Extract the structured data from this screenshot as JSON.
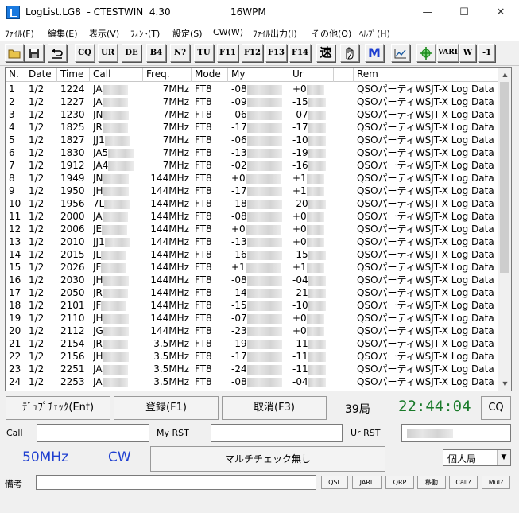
{
  "window": {
    "title": "LogList.LG8  - CTESTWIN  4.30",
    "wpm": "16WPM",
    "minimize": "—",
    "maximize": "☐",
    "close": "✕"
  },
  "menu": [
    "ﾌｧｲﾙ(F)",
    "編集(E)",
    "表示(V)",
    "ﾌｫﾝﾄ(T)",
    "設定(S)",
    "CW(W)",
    "ﾌｧｲﾙ出力(I)",
    "その他(O)",
    "ﾍﾙﾌﾟ(H)"
  ],
  "toolbar": {
    "buttons": [
      "CQ",
      "UR",
      "DE",
      "B4",
      "N?",
      "TU",
      "F11",
      "F12",
      "F13",
      "F14"
    ],
    "speed": "速",
    "m_label": "M",
    "vari": "VARI",
    "w": "W",
    "minus1": "-1"
  },
  "log": {
    "columns": [
      "N.",
      "Date",
      "Time",
      "Call",
      "Freq.",
      "Mode",
      "My",
      "Ur",
      "",
      "",
      "Rem"
    ],
    "rows": [
      {
        "n": "1",
        "date": "1/2",
        "time": "1224",
        "call": "JA",
        "freq": "7MHz",
        "mode": "FT8",
        "my": "-08",
        "ur": "+0",
        "rem": "QSOパーティWSJT-X Log Data"
      },
      {
        "n": "2",
        "date": "1/2",
        "time": "1227",
        "call": "JA",
        "freq": "7MHz",
        "mode": "FT8",
        "my": "-09",
        "ur": "-15",
        "rem": "QSOパーティWSJT-X Log Data"
      },
      {
        "n": "3",
        "date": "1/2",
        "time": "1230",
        "call": "JN",
        "freq": "7MHz",
        "mode": "FT8",
        "my": "-06",
        "ur": "-07",
        "rem": "QSOパーティWSJT-X Log Data"
      },
      {
        "n": "4",
        "date": "1/2",
        "time": "1825",
        "call": "JR",
        "freq": "7MHz",
        "mode": "FT8",
        "my": "-17",
        "ur": "-17",
        "rem": "QSOパーティWSJT-X Log Data"
      },
      {
        "n": "5",
        "date": "1/2",
        "time": "1827",
        "call": "JJ1",
        "freq": "7MHz",
        "mode": "FT8",
        "my": "-06",
        "ur": "-10",
        "rem": "QSOパーティWSJT-X Log Data"
      },
      {
        "n": "6",
        "date": "1/2",
        "time": "1830",
        "call": "JA5",
        "freq": "7MHz",
        "mode": "FT8",
        "my": "-13",
        "ur": "-19",
        "rem": "QSOパーティWSJT-X Log Data"
      },
      {
        "n": "7",
        "date": "1/2",
        "time": "1912",
        "call": "JA4",
        "freq": "7MHz",
        "mode": "FT8",
        "my": "-02",
        "ur": "-16",
        "rem": "QSOパーティWSJT-X Log Data"
      },
      {
        "n": "8",
        "date": "1/2",
        "time": "1949",
        "call": "JN",
        "freq": "144MHz",
        "mode": "FT8",
        "my": "+0",
        "ur": "+1",
        "rem": "QSOパーティWSJT-X Log Data"
      },
      {
        "n": "9",
        "date": "1/2",
        "time": "1950",
        "call": "JH",
        "freq": "144MHz",
        "mode": "FT8",
        "my": "-17",
        "ur": "+1",
        "rem": "QSOパーティWSJT-X Log Data"
      },
      {
        "n": "10",
        "date": "1/2",
        "time": "1956",
        "call": "7L",
        "freq": "144MHz",
        "mode": "FT8",
        "my": "-18",
        "ur": "-20",
        "rem": "QSOパーティWSJT-X Log Data"
      },
      {
        "n": "11",
        "date": "1/2",
        "time": "2000",
        "call": "JA",
        "freq": "144MHz",
        "mode": "FT8",
        "my": "-08",
        "ur": "+0",
        "rem": "QSOパーティWSJT-X Log Data"
      },
      {
        "n": "12",
        "date": "1/2",
        "time": "2006",
        "call": "JE",
        "freq": "144MHz",
        "mode": "FT8",
        "my": "+0",
        "ur": "+0",
        "rem": "QSOパーティWSJT-X Log Data"
      },
      {
        "n": "13",
        "date": "1/2",
        "time": "2010",
        "call": "JJ1",
        "freq": "144MHz",
        "mode": "FT8",
        "my": "-13",
        "ur": "+0",
        "rem": "QSOパーティWSJT-X Log Data"
      },
      {
        "n": "14",
        "date": "1/2",
        "time": "2015",
        "call": "JL",
        "freq": "144MHz",
        "mode": "FT8",
        "my": "-16",
        "ur": "-15",
        "rem": "QSOパーティWSJT-X Log Data"
      },
      {
        "n": "15",
        "date": "1/2",
        "time": "2026",
        "call": "JF",
        "freq": "144MHz",
        "mode": "FT8",
        "my": "+1",
        "ur": "+1",
        "rem": "QSOパーティWSJT-X Log Data"
      },
      {
        "n": "16",
        "date": "1/2",
        "time": "2030",
        "call": "JH",
        "freq": "144MHz",
        "mode": "FT8",
        "my": "-08",
        "ur": "-04",
        "rem": "QSOパーティWSJT-X Log Data"
      },
      {
        "n": "17",
        "date": "1/2",
        "time": "2050",
        "call": "JR",
        "freq": "144MHz",
        "mode": "FT8",
        "my": "-14",
        "ur": "-21",
        "rem": "QSOパーティWSJT-X Log Data"
      },
      {
        "n": "18",
        "date": "1/2",
        "time": "2101",
        "call": "JF",
        "freq": "144MHz",
        "mode": "FT8",
        "my": "-15",
        "ur": "-10",
        "rem": "QSOパーティWSJT-X Log Data"
      },
      {
        "n": "19",
        "date": "1/2",
        "time": "2110",
        "call": "JH",
        "freq": "144MHz",
        "mode": "FT8",
        "my": "-07",
        "ur": "+0",
        "rem": "QSOパーティWSJT-X Log Data"
      },
      {
        "n": "20",
        "date": "1/2",
        "time": "2112",
        "call": "JG",
        "freq": "144MHz",
        "mode": "FT8",
        "my": "-23",
        "ur": "+0",
        "rem": "QSOパーティWSJT-X Log Data"
      },
      {
        "n": "21",
        "date": "1/2",
        "time": "2154",
        "call": "JR",
        "freq": "3.5MHz",
        "mode": "FT8",
        "my": "-19",
        "ur": "-11",
        "rem": "QSOパーティWSJT-X Log Data"
      },
      {
        "n": "22",
        "date": "1/2",
        "time": "2156",
        "call": "JH",
        "freq": "3.5MHz",
        "mode": "FT8",
        "my": "-17",
        "ur": "-11",
        "rem": "QSOパーティWSJT-X Log Data"
      },
      {
        "n": "23",
        "date": "1/2",
        "time": "2251",
        "call": "JA",
        "freq": "3.5MHz",
        "mode": "FT8",
        "my": "-24",
        "ur": "-11",
        "rem": "QSOパーティWSJT-X Log Data"
      },
      {
        "n": "24",
        "date": "1/2",
        "time": "2253",
        "call": "JA",
        "freq": "3.5MHz",
        "mode": "FT8",
        "my": "-08",
        "ur": "-04",
        "rem": "QSOパーティWSJT-X Log Data"
      }
    ]
  },
  "controls": {
    "dupe_check": "ﾃﾞｭﾌﾟﾁｪｯｸ(Ent)",
    "register": "登録(F1)",
    "cancel": "取消(F3)",
    "count": "39局",
    "clock": "22:44:04",
    "cq": "CQ",
    "call_label": "Call",
    "my_rst_label": "My RST",
    "ur_rst_label": "Ur RST",
    "band": "50MHz",
    "mode": "CW",
    "multi_check": "マルチチェック無し",
    "station_type": "個人局",
    "remarks_label": "備考",
    "small_buttons": [
      "QSL",
      "JARL",
      "QRP",
      "移動",
      "Call?",
      "Mul?"
    ]
  },
  "colors": {
    "band_text": "#1f3fd0",
    "clock_text": "#1a7a2a",
    "m_icon": "#1f3fd0"
  }
}
